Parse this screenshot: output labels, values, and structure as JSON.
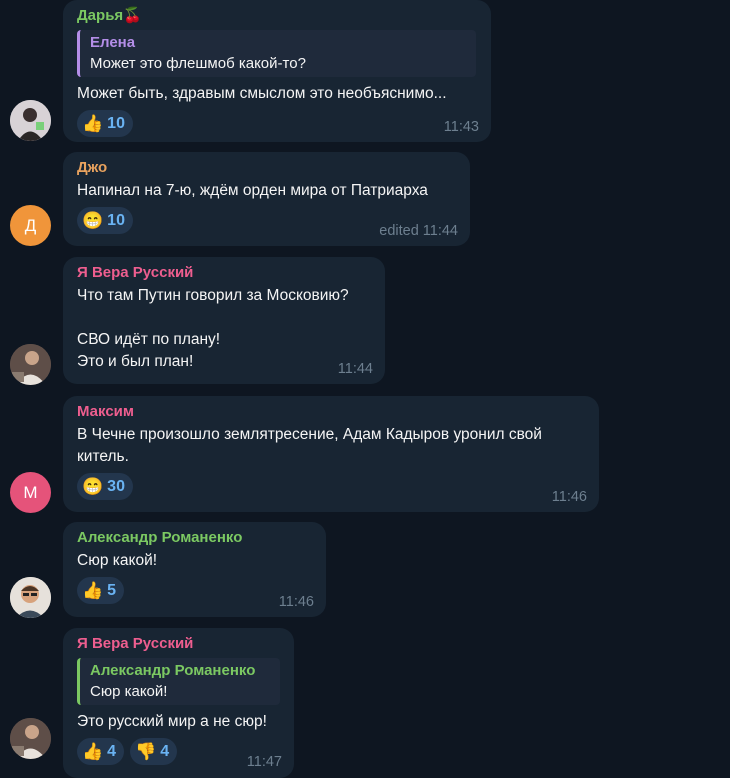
{
  "messages": [
    {
      "sender": "Дарья🍒",
      "sender_color": "#7bc862",
      "reply": {
        "name": "Елена",
        "text": "Может это флешмоб какой-то?",
        "color": "#b48ee8"
      },
      "text": "Может быть, здравым смыслом это необъяснимо...",
      "reactions": [
        {
          "emoji": "👍",
          "count": "10"
        }
      ],
      "time": "11:43",
      "avatar": {
        "kind": "photo",
        "color": "#c9c3c8"
      }
    },
    {
      "sender": "Джо",
      "sender_color": "#e8a25e",
      "text": "Напинал на 7-ю, ждём орден мира от Патриарха",
      "reactions": [
        {
          "emoji": "😁",
          "count": "10"
        }
      ],
      "time": "edited 11:44",
      "avatar": {
        "kind": "letter",
        "letter": "Д",
        "color": "#f0953a"
      }
    },
    {
      "sender": "Я Вера Русский",
      "sender_color": "#ee5e8f",
      "text": "Что там Путин говорил за Московию?\n\nСВО идёт по плану!\nЭто и был план!",
      "time": "11:44",
      "avatar": {
        "kind": "photo",
        "color": "#6b5a52"
      }
    },
    {
      "sender": "Максим",
      "sender_color": "#ee5e8f",
      "text": "В Чечне произошло землятресение, Адам Кадыров уронил свой\nкитель.",
      "reactions": [
        {
          "emoji": "😁",
          "count": "30"
        }
      ],
      "time": "11:46",
      "avatar": {
        "kind": "letter",
        "letter": "М",
        "color": "#e5537a"
      }
    },
    {
      "sender": "Александр Романенко",
      "sender_color": "#7bc862",
      "text": "Сюр какой!",
      "reactions": [
        {
          "emoji": "👍",
          "count": "5"
        }
      ],
      "time": "11:46",
      "avatar": {
        "kind": "photo",
        "color": "#d9d4ce"
      }
    },
    {
      "sender": "Я Вера Русский",
      "sender_color": "#ee5e8f",
      "reply": {
        "name": "Александр Романенко",
        "text": "Сюр какой!",
        "color": "#7bc862"
      },
      "text": "Это русский мир а не сюр!",
      "reactions": [
        {
          "emoji": "👍",
          "count": "4"
        },
        {
          "emoji": "👎",
          "count": "4"
        }
      ],
      "time": "11:47",
      "avatar": {
        "kind": "photo",
        "color": "#6b5a52"
      }
    }
  ]
}
